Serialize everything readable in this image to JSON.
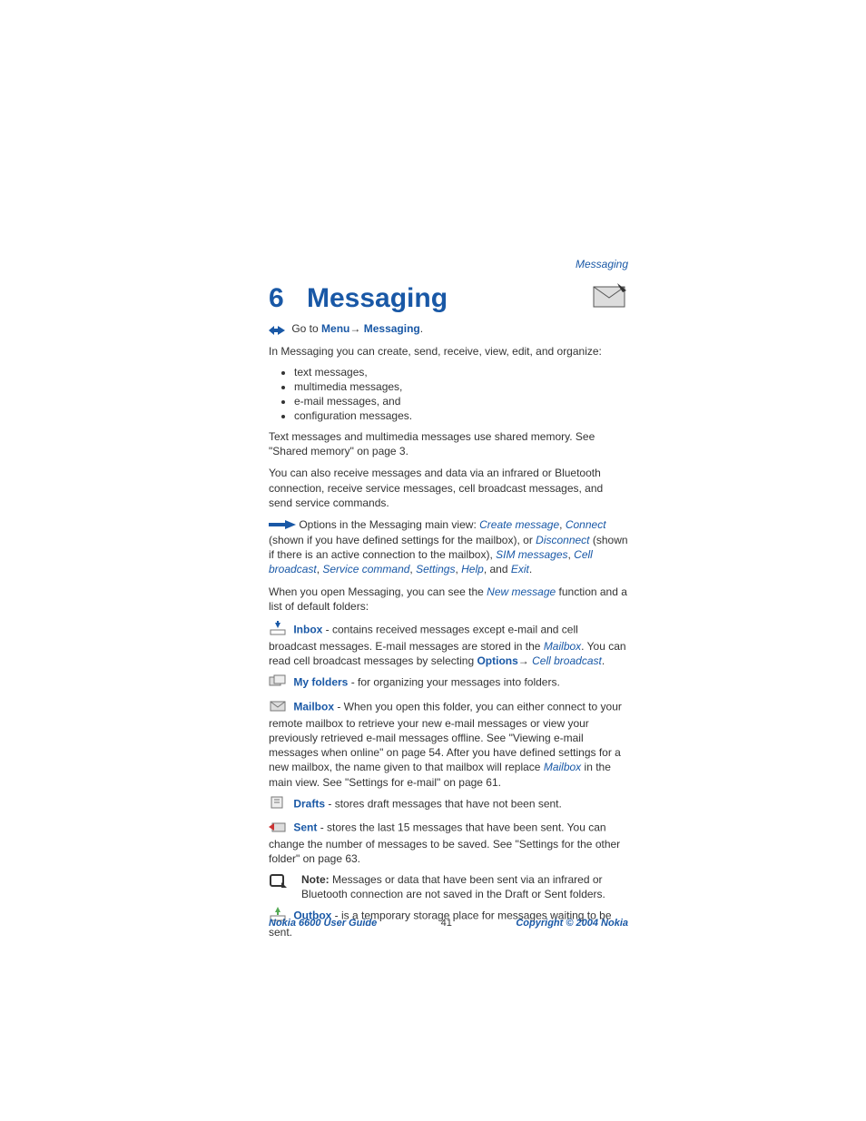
{
  "header": {
    "section": "Messaging"
  },
  "chapter": {
    "number": "6",
    "title": "Messaging"
  },
  "goto": {
    "prefix": "Go to ",
    "menu": "Menu",
    "arrow": "→ ",
    "target": "Messaging",
    "suffix": "."
  },
  "intro": "In Messaging you can create, send, receive, view, edit, and organize:",
  "bullets": [
    "text messages,",
    "multimedia messages,",
    "e-mail messages, and",
    "configuration messages."
  ],
  "p_shared": "Text messages and multimedia messages use shared memory. See \"Shared memory\" on page 3.",
  "p_also": "You can also receive messages and data via an infrared or Bluetooth connection, receive service messages, cell broadcast messages, and send service commands.",
  "options": {
    "lead": "Options in the Messaging main view: ",
    "create": "Create message",
    "sep1": ", ",
    "connect": "Connect",
    "after_connect": " (shown if you have defined settings for the mailbox), or ",
    "disconnect": "Disconnect",
    "after_disconnect": " (shown if there is an active connection to the mailbox), ",
    "sim": "SIM messages",
    "sep2": ", ",
    "cellb": "Cell broadcast",
    "sep3": ", ",
    "servcmd": "Service command",
    "sep4": ", ",
    "settings": "Settings",
    "sep5": ", ",
    "help": "Help",
    "sep6": ", and ",
    "exit": "Exit",
    "end": "."
  },
  "p_open": {
    "a": "When you open Messaging, you can see the ",
    "newmsg": "New message",
    "b": " function and a list of default folders:"
  },
  "folders": {
    "inbox": {
      "label": "Inbox",
      "a": " - contains received messages except e-mail and cell broadcast messages. E-mail messages are stored in the ",
      "mailbox": "Mailbox",
      "b": ". You can read cell broadcast messages by selecting ",
      "options": "Options",
      "arrow": "→ ",
      "cellb": "Cell broadcast",
      "end": "."
    },
    "myfolders": {
      "label": "My folders",
      "text": " - for organizing your messages into folders."
    },
    "mailbox": {
      "label": "Mailbox",
      "a": " - When you open this folder, you can either connect to your remote mailbox to retrieve your new e-mail messages or view your previously retrieved e-mail messages offline. See \"Viewing e-mail messages when online\" on page 54. After you have defined settings for a new mailbox, the name given to that mailbox will replace ",
      "mailbox_ital": "Mailbox",
      "b": " in the main view. See \"Settings for e-mail\" on page 61."
    },
    "drafts": {
      "label": "Drafts",
      "text": " - stores draft messages that have not been sent."
    },
    "sent": {
      "label": "Sent",
      "text": " - stores the last 15 messages that have been sent. You can change the number of messages to be saved. See \"Settings for the other folder\" on page 63."
    },
    "note": {
      "bold": "Note:",
      "text": " Messages or data that have been sent via an infrared or Bluetooth connection are not saved in the Draft or Sent folders."
    },
    "outbox": {
      "label": "Outbox",
      "text": " - is a temporary storage place for messages waiting to be sent."
    }
  },
  "footer": {
    "left": "Nokia 6600 User Guide",
    "page": "41",
    "right": "Copyright © 2004 Nokia"
  }
}
